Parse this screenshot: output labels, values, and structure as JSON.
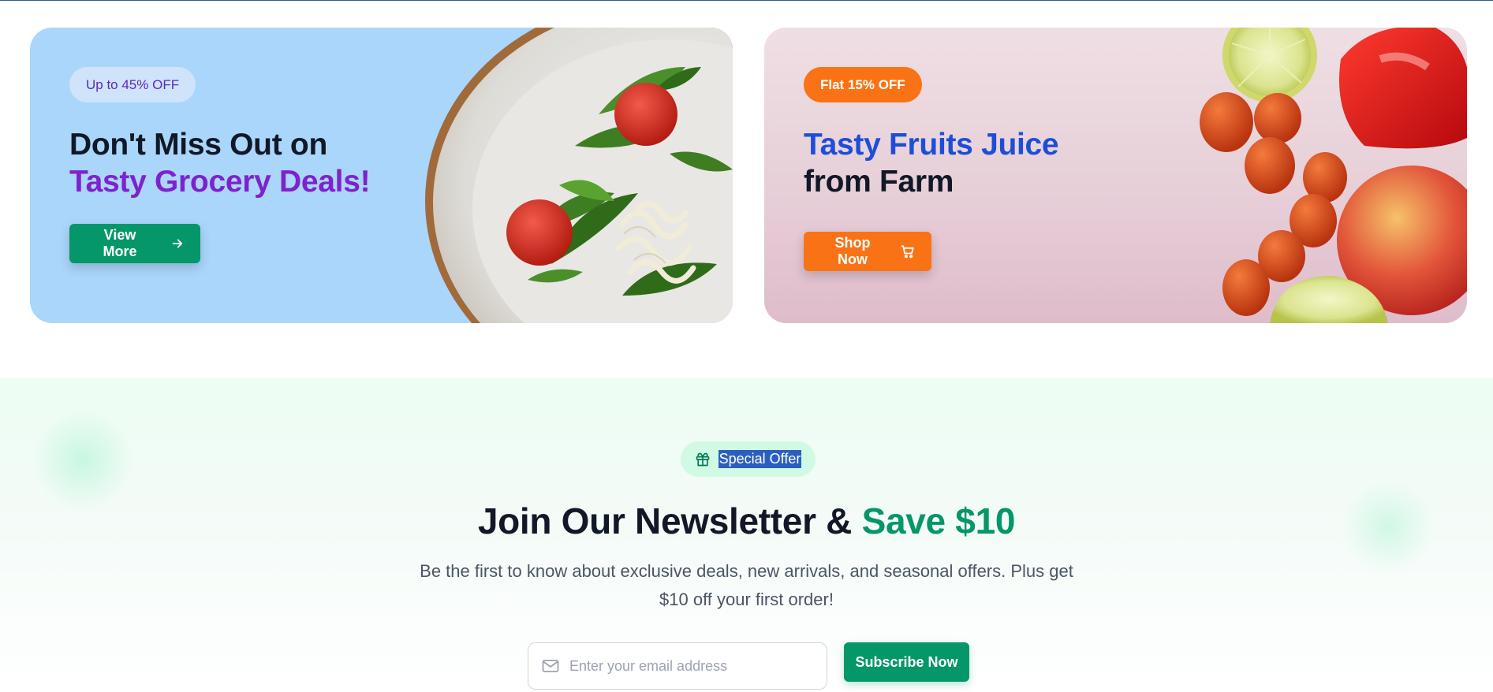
{
  "colors": {
    "green": "#059669",
    "orange": "#f97316",
    "purple": "#7e22ce",
    "blue": "#1d4ed8",
    "card_left_bg": "#aad6fb",
    "card_right_bg": "#e7cfd8"
  },
  "promo_left": {
    "badge": "Up to 45% OFF",
    "headline_line1": "Don't Miss Out on",
    "headline_line2": "Tasty Grocery Deals!",
    "button_label": "View More",
    "button_icon": "arrow-right-icon",
    "image": "salad-plate"
  },
  "promo_right": {
    "badge": "Flat 15% OFF",
    "headline_line1": "Tasty Fruits Juice",
    "headline_line2": "from Farm",
    "button_label": "Shop Now",
    "button_icon": "shopping-cart-icon",
    "image": "fruits-and-vegetables"
  },
  "newsletter": {
    "pill_icon": "gift-icon",
    "pill_label": "Special Offer",
    "title_main": "Join Our Newsletter & ",
    "title_accent": "Save $10",
    "description": "Be the first to know about exclusive deals, new arrivals, and seasonal offers. Plus get $10 off your first order!",
    "email_icon": "mail-icon",
    "email_placeholder": "Enter your email address",
    "email_value": "",
    "subscribe_label": "Subscribe Now"
  }
}
